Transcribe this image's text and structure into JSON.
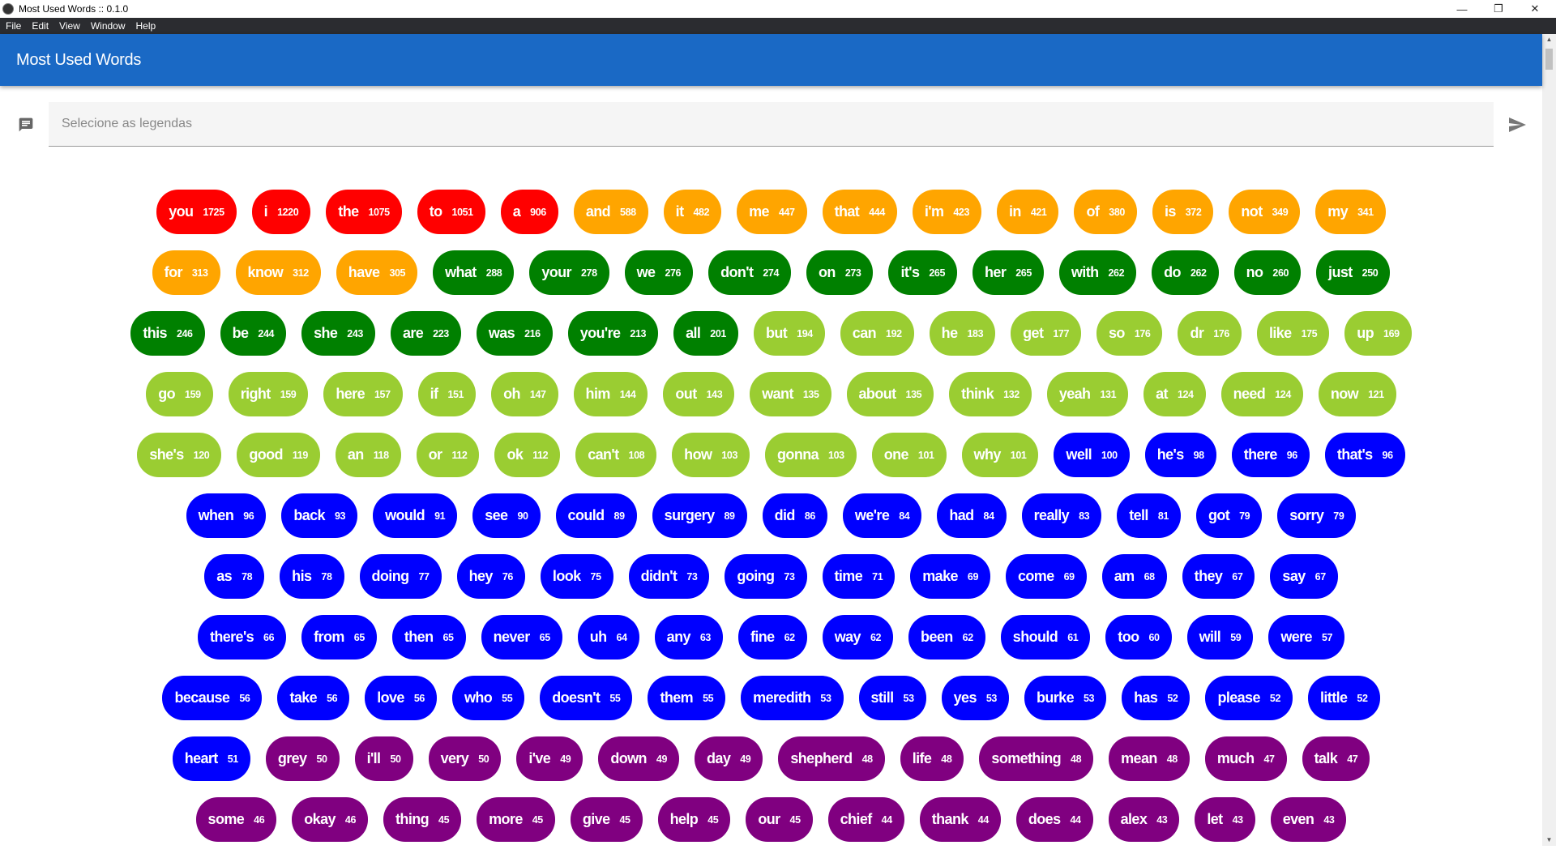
{
  "window": {
    "title": "Most Used Words :: 0.1.0",
    "controls": {
      "minimize": "—",
      "maximize": "❐",
      "close": "✕"
    }
  },
  "menu": [
    "File",
    "Edit",
    "View",
    "Window",
    "Help"
  ],
  "header": {
    "title": "Most Used Words"
  },
  "input": {
    "placeholder": "Selecione as legendas",
    "value": "",
    "left_icon": "subtitles-icon",
    "right_icon": "send-icon"
  },
  "palette": {
    "red": "#ff0000",
    "orange": "#ffa500",
    "green": "#008000",
    "lime": "#9acd32",
    "blue": "#0000ff",
    "purple": "#800080"
  },
  "rows": [
    [
      [
        "you",
        1725,
        "red"
      ],
      [
        "i",
        1220,
        "red"
      ],
      [
        "the",
        1075,
        "red"
      ],
      [
        "to",
        1051,
        "red"
      ],
      [
        "a",
        906,
        "red"
      ],
      [
        "and",
        588,
        "orange"
      ],
      [
        "it",
        482,
        "orange"
      ],
      [
        "me",
        447,
        "orange"
      ],
      [
        "that",
        444,
        "orange"
      ],
      [
        "i'm",
        423,
        "orange"
      ],
      [
        "in",
        421,
        "orange"
      ],
      [
        "of",
        380,
        "orange"
      ],
      [
        "is",
        372,
        "orange"
      ],
      [
        "not",
        349,
        "orange"
      ],
      [
        "my",
        341,
        "orange"
      ]
    ],
    [
      [
        "for",
        313,
        "orange"
      ],
      [
        "know",
        312,
        "orange"
      ],
      [
        "have",
        305,
        "orange"
      ],
      [
        "what",
        288,
        "green"
      ],
      [
        "your",
        278,
        "green"
      ],
      [
        "we",
        276,
        "green"
      ],
      [
        "don't",
        274,
        "green"
      ],
      [
        "on",
        273,
        "green"
      ],
      [
        "it's",
        265,
        "green"
      ],
      [
        "her",
        265,
        "green"
      ],
      [
        "with",
        262,
        "green"
      ],
      [
        "do",
        262,
        "green"
      ],
      [
        "no",
        260,
        "green"
      ],
      [
        "just",
        250,
        "green"
      ]
    ],
    [
      [
        "this",
        246,
        "green"
      ],
      [
        "be",
        244,
        "green"
      ],
      [
        "she",
        243,
        "green"
      ],
      [
        "are",
        223,
        "green"
      ],
      [
        "was",
        216,
        "green"
      ],
      [
        "you're",
        213,
        "green"
      ],
      [
        "all",
        201,
        "green"
      ],
      [
        "but",
        194,
        "lime"
      ],
      [
        "can",
        192,
        "lime"
      ],
      [
        "he",
        183,
        "lime"
      ],
      [
        "get",
        177,
        "lime"
      ],
      [
        "so",
        176,
        "lime"
      ],
      [
        "dr",
        176,
        "lime"
      ],
      [
        "like",
        175,
        "lime"
      ],
      [
        "up",
        169,
        "lime"
      ]
    ],
    [
      [
        "go",
        159,
        "lime"
      ],
      [
        "right",
        159,
        "lime"
      ],
      [
        "here",
        157,
        "lime"
      ],
      [
        "if",
        151,
        "lime"
      ],
      [
        "oh",
        147,
        "lime"
      ],
      [
        "him",
        144,
        "lime"
      ],
      [
        "out",
        143,
        "lime"
      ],
      [
        "want",
        135,
        "lime"
      ],
      [
        "about",
        135,
        "lime"
      ],
      [
        "think",
        132,
        "lime"
      ],
      [
        "yeah",
        131,
        "lime"
      ],
      [
        "at",
        124,
        "lime"
      ],
      [
        "need",
        124,
        "lime"
      ],
      [
        "now",
        121,
        "lime"
      ]
    ],
    [
      [
        "she's",
        120,
        "lime"
      ],
      [
        "good",
        119,
        "lime"
      ],
      [
        "an",
        118,
        "lime"
      ],
      [
        "or",
        112,
        "lime"
      ],
      [
        "ok",
        112,
        "lime"
      ],
      [
        "can't",
        108,
        "lime"
      ],
      [
        "how",
        103,
        "lime"
      ],
      [
        "gonna",
        103,
        "lime"
      ],
      [
        "one",
        101,
        "lime"
      ],
      [
        "why",
        101,
        "lime"
      ],
      [
        "well",
        100,
        "blue"
      ],
      [
        "he's",
        98,
        "blue"
      ],
      [
        "there",
        96,
        "blue"
      ],
      [
        "that's",
        96,
        "blue"
      ]
    ],
    [
      [
        "when",
        96,
        "blue"
      ],
      [
        "back",
        93,
        "blue"
      ],
      [
        "would",
        91,
        "blue"
      ],
      [
        "see",
        90,
        "blue"
      ],
      [
        "could",
        89,
        "blue"
      ],
      [
        "surgery",
        89,
        "blue"
      ],
      [
        "did",
        86,
        "blue"
      ],
      [
        "we're",
        84,
        "blue"
      ],
      [
        "had",
        84,
        "blue"
      ],
      [
        "really",
        83,
        "blue"
      ],
      [
        "tell",
        81,
        "blue"
      ],
      [
        "got",
        79,
        "blue"
      ],
      [
        "sorry",
        79,
        "blue"
      ]
    ],
    [
      [
        "as",
        78,
        "blue"
      ],
      [
        "his",
        78,
        "blue"
      ],
      [
        "doing",
        77,
        "blue"
      ],
      [
        "hey",
        76,
        "blue"
      ],
      [
        "look",
        75,
        "blue"
      ],
      [
        "didn't",
        73,
        "blue"
      ],
      [
        "going",
        73,
        "blue"
      ],
      [
        "time",
        71,
        "blue"
      ],
      [
        "make",
        69,
        "blue"
      ],
      [
        "come",
        69,
        "blue"
      ],
      [
        "am",
        68,
        "blue"
      ],
      [
        "they",
        67,
        "blue"
      ],
      [
        "say",
        67,
        "blue"
      ]
    ],
    [
      [
        "there's",
        66,
        "blue"
      ],
      [
        "from",
        65,
        "blue"
      ],
      [
        "then",
        65,
        "blue"
      ],
      [
        "never",
        65,
        "blue"
      ],
      [
        "uh",
        64,
        "blue"
      ],
      [
        "any",
        63,
        "blue"
      ],
      [
        "fine",
        62,
        "blue"
      ],
      [
        "way",
        62,
        "blue"
      ],
      [
        "been",
        62,
        "blue"
      ],
      [
        "should",
        61,
        "blue"
      ],
      [
        "too",
        60,
        "blue"
      ],
      [
        "will",
        59,
        "blue"
      ],
      [
        "were",
        57,
        "blue"
      ]
    ],
    [
      [
        "because",
        56,
        "blue"
      ],
      [
        "take",
        56,
        "blue"
      ],
      [
        "love",
        56,
        "blue"
      ],
      [
        "who",
        55,
        "blue"
      ],
      [
        "doesn't",
        55,
        "blue"
      ],
      [
        "them",
        55,
        "blue"
      ],
      [
        "meredith",
        53,
        "blue"
      ],
      [
        "still",
        53,
        "blue"
      ],
      [
        "yes",
        53,
        "blue"
      ],
      [
        "burke",
        53,
        "blue"
      ],
      [
        "has",
        52,
        "blue"
      ],
      [
        "please",
        52,
        "blue"
      ],
      [
        "little",
        52,
        "blue"
      ]
    ],
    [
      [
        "heart",
        51,
        "blue"
      ],
      [
        "grey",
        50,
        "purple"
      ],
      [
        "i'll",
        50,
        "purple"
      ],
      [
        "very",
        50,
        "purple"
      ],
      [
        "i've",
        49,
        "purple"
      ],
      [
        "down",
        49,
        "purple"
      ],
      [
        "day",
        49,
        "purple"
      ],
      [
        "shepherd",
        48,
        "purple"
      ],
      [
        "life",
        48,
        "purple"
      ],
      [
        "something",
        48,
        "purple"
      ],
      [
        "mean",
        48,
        "purple"
      ],
      [
        "much",
        47,
        "purple"
      ],
      [
        "talk",
        47,
        "purple"
      ]
    ],
    [
      [
        "some",
        46,
        "purple"
      ],
      [
        "okay",
        46,
        "purple"
      ],
      [
        "thing",
        45,
        "purple"
      ],
      [
        "more",
        45,
        "purple"
      ],
      [
        "give",
        45,
        "purple"
      ],
      [
        "help",
        45,
        "purple"
      ],
      [
        "our",
        45,
        "purple"
      ],
      [
        "chief",
        44,
        "purple"
      ],
      [
        "thank",
        44,
        "purple"
      ],
      [
        "does",
        44,
        "purple"
      ],
      [
        "alex",
        43,
        "purple"
      ],
      [
        "let",
        43,
        "purple"
      ],
      [
        "even",
        43,
        "purple"
      ]
    ]
  ]
}
